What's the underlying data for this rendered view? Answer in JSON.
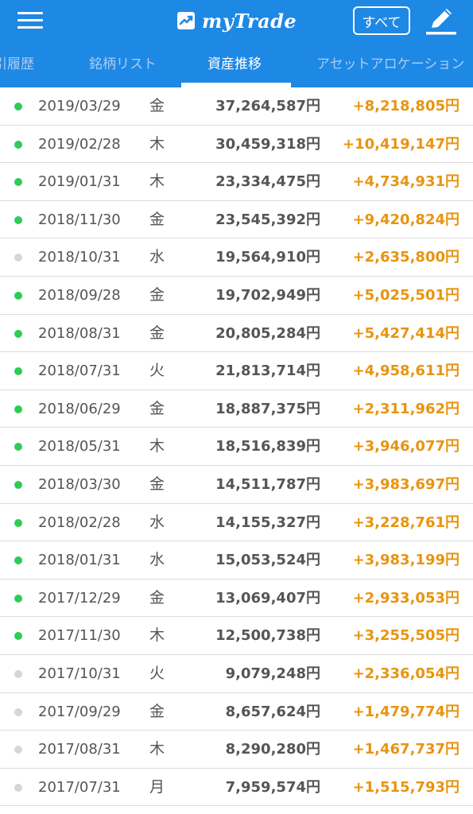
{
  "header": {
    "app_name": "myTrade",
    "filter_label": "すべて"
  },
  "tabs": [
    {
      "label": "引履歴"
    },
    {
      "label": "銘柄リスト"
    },
    {
      "label": "資産推移"
    },
    {
      "label": "アセットアロケーション"
    }
  ],
  "colors": {
    "primary": "#1e88e5",
    "gain": "#e8940f",
    "dot_active": "#2ecc54",
    "dot_inactive": "#d6d6d6"
  },
  "rows": [
    {
      "date": "2019/03/29",
      "dow": "金",
      "amount": "37,264,587円",
      "gain": "+8,218,805円",
      "status": "active"
    },
    {
      "date": "2019/02/28",
      "dow": "木",
      "amount": "30,459,318円",
      "gain": "+10,419,147円",
      "status": "active"
    },
    {
      "date": "2019/01/31",
      "dow": "木",
      "amount": "23,334,475円",
      "gain": "+4,734,931円",
      "status": "active"
    },
    {
      "date": "2018/11/30",
      "dow": "金",
      "amount": "23,545,392円",
      "gain": "+9,420,824円",
      "status": "active"
    },
    {
      "date": "2018/10/31",
      "dow": "水",
      "amount": "19,564,910円",
      "gain": "+2,635,800円",
      "status": "inactive"
    },
    {
      "date": "2018/09/28",
      "dow": "金",
      "amount": "19,702,949円",
      "gain": "+5,025,501円",
      "status": "active"
    },
    {
      "date": "2018/08/31",
      "dow": "金",
      "amount": "20,805,284円",
      "gain": "+5,427,414円",
      "status": "active"
    },
    {
      "date": "2018/07/31",
      "dow": "火",
      "amount": "21,813,714円",
      "gain": "+4,958,611円",
      "status": "active"
    },
    {
      "date": "2018/06/29",
      "dow": "金",
      "amount": "18,887,375円",
      "gain": "+2,311,962円",
      "status": "active"
    },
    {
      "date": "2018/05/31",
      "dow": "木",
      "amount": "18,516,839円",
      "gain": "+3,946,077円",
      "status": "active"
    },
    {
      "date": "2018/03/30",
      "dow": "金",
      "amount": "14,511,787円",
      "gain": "+3,983,697円",
      "status": "active"
    },
    {
      "date": "2018/02/28",
      "dow": "水",
      "amount": "14,155,327円",
      "gain": "+3,228,761円",
      "status": "active"
    },
    {
      "date": "2018/01/31",
      "dow": "水",
      "amount": "15,053,524円",
      "gain": "+3,983,199円",
      "status": "active"
    },
    {
      "date": "2017/12/29",
      "dow": "金",
      "amount": "13,069,407円",
      "gain": "+2,933,053円",
      "status": "active"
    },
    {
      "date": "2017/11/30",
      "dow": "木",
      "amount": "12,500,738円",
      "gain": "+3,255,505円",
      "status": "active"
    },
    {
      "date": "2017/10/31",
      "dow": "火",
      "amount": "9,079,248円",
      "gain": "+2,336,054円",
      "status": "inactive"
    },
    {
      "date": "2017/09/29",
      "dow": "金",
      "amount": "8,657,624円",
      "gain": "+1,479,774円",
      "status": "inactive"
    },
    {
      "date": "2017/08/31",
      "dow": "木",
      "amount": "8,290,280円",
      "gain": "+1,467,737円",
      "status": "inactive"
    },
    {
      "date": "2017/07/31",
      "dow": "月",
      "amount": "7,959,574円",
      "gain": "+1,515,793円",
      "status": "inactive"
    }
  ]
}
